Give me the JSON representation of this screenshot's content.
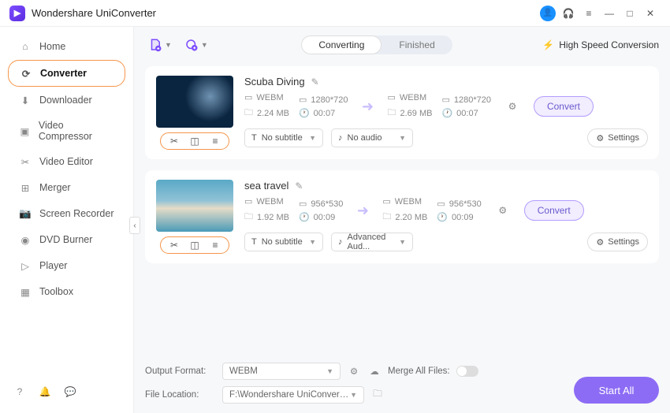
{
  "title": "Wondershare UniConverter",
  "sidebar": {
    "items": [
      {
        "label": "Home"
      },
      {
        "label": "Converter"
      },
      {
        "label": "Downloader"
      },
      {
        "label": "Video Compressor"
      },
      {
        "label": "Video Editor"
      },
      {
        "label": "Merger"
      },
      {
        "label": "Screen Recorder"
      },
      {
        "label": "DVD Burner"
      },
      {
        "label": "Player"
      },
      {
        "label": "Toolbox"
      }
    ]
  },
  "tabs": {
    "converting": "Converting",
    "finished": "Finished"
  },
  "hsc": "High Speed Conversion",
  "files": [
    {
      "name": "Scuba Diving",
      "src": {
        "format": "WEBM",
        "res": "1280*720",
        "size": "2.24 MB",
        "dur": "00:07"
      },
      "dst": {
        "format": "WEBM",
        "res": "1280*720",
        "size": "2.69 MB",
        "dur": "00:07"
      },
      "subtitle": "No subtitle",
      "audio": "No audio",
      "convert": "Convert",
      "settings": "Settings"
    },
    {
      "name": "sea travel",
      "src": {
        "format": "WEBM",
        "res": "956*530",
        "size": "1.92 MB",
        "dur": "00:09"
      },
      "dst": {
        "format": "WEBM",
        "res": "956*530",
        "size": "2.20 MB",
        "dur": "00:09"
      },
      "subtitle": "No subtitle",
      "audio": "Advanced Aud...",
      "convert": "Convert",
      "settings": "Settings"
    }
  ],
  "footer": {
    "output_format_label": "Output Format:",
    "output_format": "WEBM",
    "file_location_label": "File Location:",
    "file_location": "F:\\Wondershare UniConverter",
    "merge_label": "Merge All Files:",
    "start_all": "Start All"
  }
}
